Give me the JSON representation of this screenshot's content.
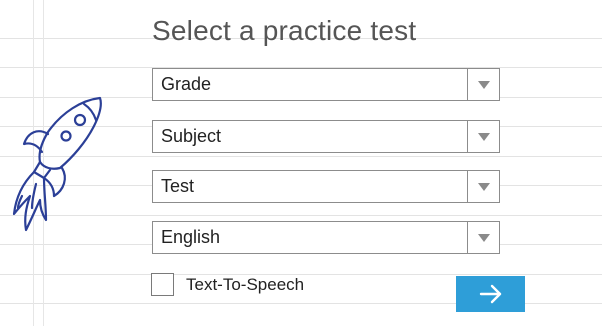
{
  "page": {
    "title": "Select a practice test"
  },
  "form": {
    "grade": {
      "value": "Grade"
    },
    "subject": {
      "value": "Subject"
    },
    "test": {
      "value": "Test"
    },
    "language": {
      "value": "English"
    },
    "tts": {
      "label": "Text-To-Speech",
      "checked": false
    },
    "submit": {
      "icon": "arrow-right-icon"
    }
  },
  "colors": {
    "accent": "#2e9ed8",
    "rocket": "#2b3f97",
    "title": "#555555"
  }
}
